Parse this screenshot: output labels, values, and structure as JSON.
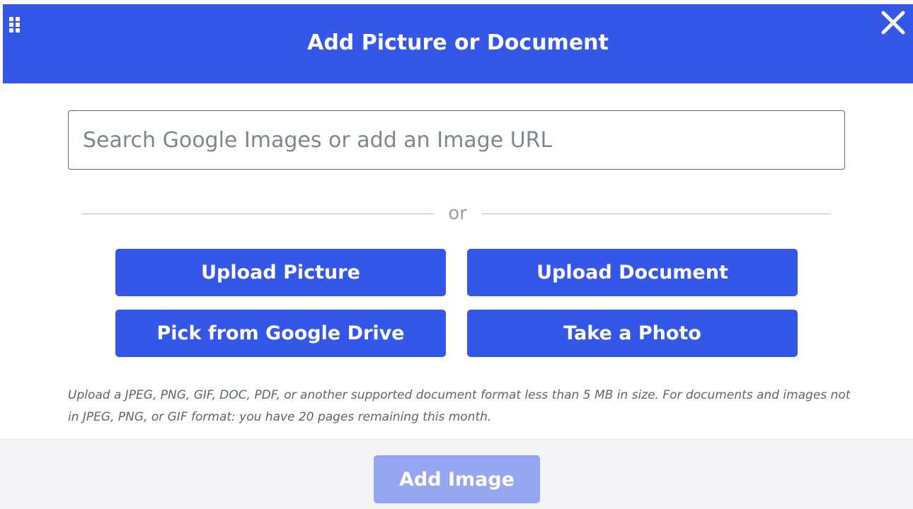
{
  "dialog": {
    "title": "Add Picture or Document",
    "drag_icon": "drag-handle-icon",
    "close_icon": "close-icon"
  },
  "search": {
    "placeholder": "Search Google Images or add an Image URL",
    "value": ""
  },
  "divider": {
    "text": "or"
  },
  "buttons": {
    "upload_picture": "Upload Picture",
    "upload_document": "Upload Document",
    "pick_google_drive": "Pick from Google Drive",
    "take_photo": "Take a Photo"
  },
  "info": {
    "text": "Upload a JPEG, PNG, GIF, DOC, PDF, or another supported document format less than 5 MB in size. For documents and images not in JPEG, PNG, or GIF format: you have 20 pages remaining this month."
  },
  "footer": {
    "add_image_label": "Add Image",
    "add_image_enabled": false
  },
  "colors": {
    "primary": "#3457e8",
    "primary_disabled": "#94a6f1",
    "footer_bg": "#f3f4f7"
  }
}
